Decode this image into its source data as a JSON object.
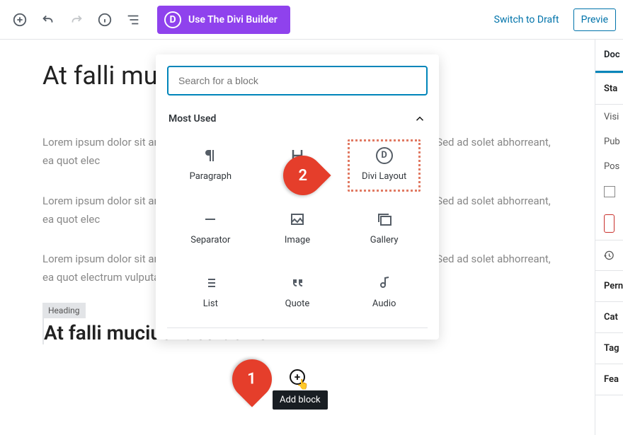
{
  "toolbar": {
    "divi_button": "Use The Divi Builder",
    "switch_draft": "Switch to Draft",
    "preview": "Previe"
  },
  "sidebar": {
    "tab": "Doc",
    "status_heading": "Sta",
    "visibility": "Visi",
    "publish": "Pub",
    "post_format": "Pos",
    "permalink": "Pern",
    "categories": "Cat",
    "tags": "Tag",
    "featured": "Fea"
  },
  "post": {
    "title": "At falli muci",
    "para": "Lorem ipsum dolor sit an                                                                                           d his summo habemus deleniti. Enim oratio qui                                                                                          nt ut cum. Sed ad solet abhorreant, ea quot elec",
    "para3": "Lorem ipsum dolor sit an                                                                                           d his summo habemus deleniti. Enim oratio qui                                                                                          nt ut cum. Sed ad solet abhorreant, ea quot electrum vulputate vis. . . o cete.   s disputationi id cum.",
    "heading_tag": "Heading",
    "heading_text": "At falli mucius fabulas ve"
  },
  "inserter": {
    "search_placeholder": "Search for a block",
    "category": "Most Used",
    "blocks": {
      "paragraph": "Paragraph",
      "heading": "Hea      g",
      "divi": "Divi Layout",
      "separator": "Separator",
      "image": "Image",
      "gallery": "Gallery",
      "list": "List",
      "quote": "Quote",
      "audio": "Audio"
    }
  },
  "tooltip": {
    "add_block": "Add block"
  },
  "pins": {
    "one": "1",
    "two": "2"
  }
}
